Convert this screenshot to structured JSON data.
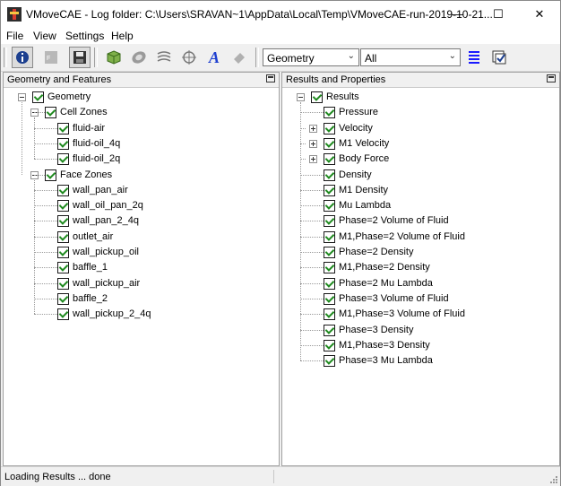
{
  "window": {
    "title": "VMoveCAE - Log folder: C:\\Users\\SRAVAN~1\\AppData\\Local\\Temp\\VMoveCAE-run-2019-10-21..."
  },
  "menu": [
    "File",
    "View",
    "Settings",
    "Help"
  ],
  "toolbar": {
    "combo1_value": "Geometry",
    "combo2_value": "All",
    "text_tool": "A"
  },
  "left_panel": {
    "title": "Geometry and Features",
    "root": "Geometry",
    "groups": [
      {
        "label": "Cell Zones",
        "children": [
          "fluid-air",
          "fluid-oil_4q",
          "fluid-oil_2q"
        ]
      },
      {
        "label": "Face Zones",
        "children": [
          "wall_pan_air",
          "wall_oil_pan_2q",
          "wall_pan_2_4q",
          "outlet_air",
          "wall_pickup_oil",
          "baffle_1",
          "wall_pickup_air",
          "baffle_2",
          "wall_pickup_2_4q"
        ]
      }
    ]
  },
  "right_panel": {
    "title": "Results and Properties",
    "root": "Results",
    "items": [
      {
        "label": "Pressure",
        "expandable": false
      },
      {
        "label": "Velocity",
        "expandable": true
      },
      {
        "label": "M1 Velocity",
        "expandable": true
      },
      {
        "label": "Body Force",
        "expandable": true
      },
      {
        "label": "Density",
        "expandable": false
      },
      {
        "label": "M1 Density",
        "expandable": false
      },
      {
        "label": "Mu Lambda",
        "expandable": false
      },
      {
        "label": "Phase=2 Volume of Fluid",
        "expandable": false
      },
      {
        "label": "M1,Phase=2 Volume of Fluid",
        "expandable": false
      },
      {
        "label": "Phase=2 Density",
        "expandable": false
      },
      {
        "label": "M1,Phase=2 Density",
        "expandable": false
      },
      {
        "label": "Phase=2 Mu Lambda",
        "expandable": false
      },
      {
        "label": "Phase=3 Volume of Fluid",
        "expandable": false
      },
      {
        "label": "M1,Phase=3 Volume of Fluid",
        "expandable": false
      },
      {
        "label": "Phase=3 Density",
        "expandable": false
      },
      {
        "label": "M1,Phase=3 Density",
        "expandable": false
      },
      {
        "label": "Phase=3 Mu Lambda",
        "expandable": false
      }
    ]
  },
  "status": {
    "text": "Loading Results ... done"
  },
  "colors": {
    "check": "#1f8a1f",
    "list_blue": "#1a1aff",
    "text_blue": "#1e3fd0"
  }
}
